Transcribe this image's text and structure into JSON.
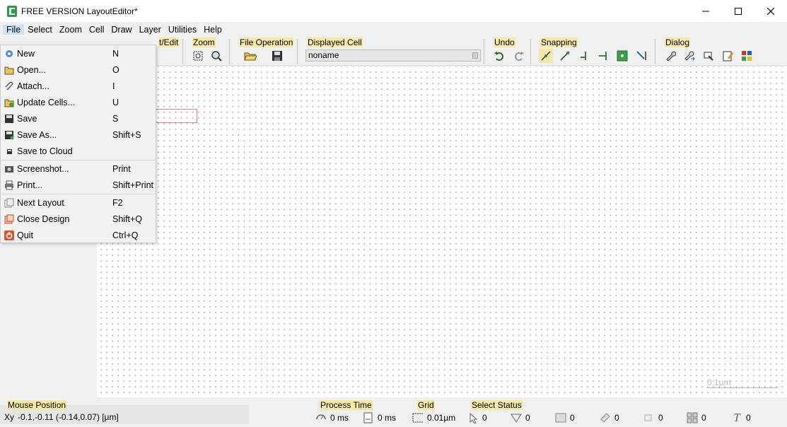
{
  "window": {
    "title": "FREE VERSION LayoutEditor*"
  },
  "menubar": [
    "File",
    "Select",
    "Zoom",
    "Cell",
    "Draw",
    "Layer",
    "Utilities",
    "Help"
  ],
  "file_menu": {
    "groups": [
      [
        {
          "label": "New",
          "shortcut": "N",
          "icon": "new-file-icon"
        },
        {
          "label": "Open...",
          "shortcut": "O",
          "icon": "open-folder-icon"
        },
        {
          "label": "Attach...",
          "shortcut": "I",
          "icon": "paperclip-icon"
        },
        {
          "label": "Update Cells...",
          "shortcut": "U",
          "icon": "update-folder-icon"
        },
        {
          "label": "Save",
          "shortcut": "S",
          "icon": "save-disk-icon"
        },
        {
          "label": "Save As...",
          "shortcut": "Shift+S",
          "icon": "save-as-disk-icon"
        },
        {
          "label": "Save to Cloud",
          "shortcut": "",
          "icon": "cloud-save-icon"
        }
      ],
      [
        {
          "label": "Screenshot...",
          "shortcut": "Print",
          "icon": "camera-icon"
        },
        {
          "label": "Print...",
          "shortcut": "Shift+Print",
          "icon": "printer-icon"
        }
      ],
      [
        {
          "label": "Next Layout",
          "shortcut": "F2",
          "icon": "next-layout-icon"
        },
        {
          "label": "Close Design",
          "shortcut": "Shift+Q",
          "icon": "close-design-icon"
        },
        {
          "label": "Quit",
          "shortcut": "Ctrl+Q",
          "icon": "power-icon"
        }
      ]
    ]
  },
  "toolbar": {
    "edit_label": "t/Edit",
    "zoom_label": "Zoom",
    "file_operation_label": "File Operation",
    "displayed_cell_label": "Displayed Cell",
    "displayed_cell_value": "noname",
    "undo_label": "Undo",
    "snapping_label": "Snapping",
    "dialog_label": "Dialog"
  },
  "statusbar": {
    "mouse_position_label": "Mouse Position",
    "xy_symbol": "Xy",
    "mouse_position_value": "-0.1,-0.11 (-0.14,0.07) [µm]",
    "process_time_label": "Process Time",
    "process_time_1": "0 ms",
    "process_time_2": "0 ms",
    "grid_label": "Grid",
    "grid_value": "0.01µm",
    "select_status_label": "Select Status",
    "select_counts": [
      "0",
      "0",
      "0",
      "0",
      "0",
      "0",
      "0"
    ]
  },
  "canvas": {
    "scale_label": "0.1µm"
  },
  "colors": {
    "label_highlight": "#f5e9a8",
    "menu_bg": "#f2f2f2",
    "cell_outline": "#c98a8a"
  }
}
